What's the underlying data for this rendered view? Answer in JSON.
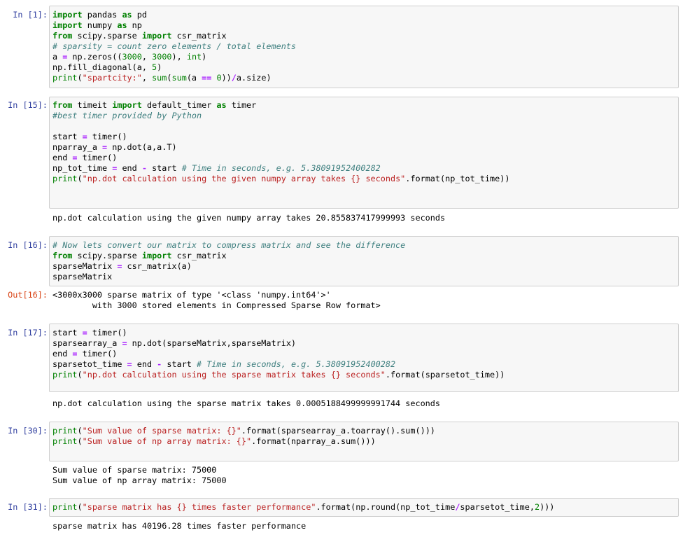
{
  "cells": [
    {
      "prompt": "In [1]:",
      "code": [
        [
          [
            "kw",
            "import"
          ],
          [
            "t",
            " pandas "
          ],
          [
            "kw",
            "as"
          ],
          [
            "t",
            " pd"
          ]
        ],
        [
          [
            "kw",
            "import"
          ],
          [
            "t",
            " numpy "
          ],
          [
            "kw",
            "as"
          ],
          [
            "t",
            " np"
          ]
        ],
        [
          [
            "kw",
            "from"
          ],
          [
            "t",
            " scipy.sparse "
          ],
          [
            "kw",
            "import"
          ],
          [
            "t",
            " csr_matrix"
          ]
        ],
        [
          [
            "cm",
            "# sparsity = count zero elements / total elements"
          ]
        ],
        [
          [
            "t",
            "a "
          ],
          [
            "op",
            "="
          ],
          [
            "t",
            " np.zeros(("
          ],
          [
            "nu",
            "3000"
          ],
          [
            "t",
            ", "
          ],
          [
            "nu",
            "3000"
          ],
          [
            "t",
            "), "
          ],
          [
            "bi",
            "int"
          ],
          [
            "t",
            ")"
          ]
        ],
        [
          [
            "t",
            "np.fill_diagonal(a, "
          ],
          [
            "nu",
            "5"
          ],
          [
            "t",
            ")"
          ]
        ],
        [
          [
            "bi",
            "print"
          ],
          [
            "t",
            "("
          ],
          [
            "st",
            "\"spartcity:\""
          ],
          [
            "t",
            ", "
          ],
          [
            "bi",
            "sum"
          ],
          [
            "t",
            "("
          ],
          [
            "bi",
            "sum"
          ],
          [
            "t",
            "(a "
          ],
          [
            "op",
            "=="
          ],
          [
            "t",
            " "
          ],
          [
            "nu",
            "0"
          ],
          [
            "t",
            "))"
          ],
          [
            "op",
            "/"
          ],
          [
            "t",
            "a.size)"
          ]
        ]
      ],
      "output": []
    },
    {
      "prompt": "In [15]:",
      "code": [
        [
          [
            "kw",
            "from"
          ],
          [
            "t",
            " timeit "
          ],
          [
            "kw",
            "import"
          ],
          [
            "t",
            " default_timer "
          ],
          [
            "kw",
            "as"
          ],
          [
            "t",
            " timer"
          ]
        ],
        [
          [
            "cm",
            "#best timer provided by Python"
          ]
        ],
        [
          [
            "t",
            ""
          ]
        ],
        [
          [
            "t",
            "start "
          ],
          [
            "op",
            "="
          ],
          [
            "t",
            " timer()"
          ]
        ],
        [
          [
            "t",
            "nparray_a "
          ],
          [
            "op",
            "="
          ],
          [
            "t",
            " np.dot(a,a.T)"
          ]
        ],
        [
          [
            "t",
            "end "
          ],
          [
            "op",
            "="
          ],
          [
            "t",
            " timer()"
          ]
        ],
        [
          [
            "t",
            "np_tot_time "
          ],
          [
            "op",
            "="
          ],
          [
            "t",
            " end "
          ],
          [
            "op",
            "-"
          ],
          [
            "t",
            " start "
          ],
          [
            "cm",
            "# Time in seconds, e.g. 5.38091952400282"
          ]
        ],
        [
          [
            "bi",
            "print"
          ],
          [
            "t",
            "("
          ],
          [
            "st",
            "\"np.dot calculation using the given numpy array takes {} seconds\""
          ],
          [
            "t",
            ".format(np_tot_time))"
          ]
        ],
        [
          [
            "t",
            ""
          ]
        ],
        [
          [
            "t",
            ""
          ]
        ]
      ],
      "output": [
        "np.dot calculation using the given numpy array takes 20.855837417999993 seconds"
      ]
    },
    {
      "prompt": "In [16]:",
      "code": [
        [
          [
            "cm",
            "# Now lets convert our matrix to compress matrix and see the difference"
          ]
        ],
        [
          [
            "kw",
            "from"
          ],
          [
            "t",
            " scipy.sparse "
          ],
          [
            "kw",
            "import"
          ],
          [
            "t",
            " csr_matrix"
          ]
        ],
        [
          [
            "t",
            "sparseMatrix "
          ],
          [
            "op",
            "="
          ],
          [
            "t",
            " csr_matrix(a)"
          ]
        ],
        [
          [
            "t",
            "sparseMatrix"
          ]
        ]
      ],
      "out_prompt": "Out[16]:",
      "output": [
        "<3000x3000 sparse matrix of type '<class 'numpy.int64'>'",
        "        with 3000 stored elements in Compressed Sparse Row format>"
      ]
    },
    {
      "prompt": "In [17]:",
      "code": [
        [
          [
            "t",
            "start "
          ],
          [
            "op",
            "="
          ],
          [
            "t",
            " timer()"
          ]
        ],
        [
          [
            "t",
            "sparsearray_a "
          ],
          [
            "op",
            "="
          ],
          [
            "t",
            " np.dot(sparseMatrix,sparseMatrix)"
          ]
        ],
        [
          [
            "t",
            "end "
          ],
          [
            "op",
            "="
          ],
          [
            "t",
            " timer()"
          ]
        ],
        [
          [
            "t",
            "sparsetot_time "
          ],
          [
            "op",
            "="
          ],
          [
            "t",
            " end "
          ],
          [
            "op",
            "-"
          ],
          [
            "t",
            " start "
          ],
          [
            "cm",
            "# Time in seconds, e.g. 5.38091952400282"
          ]
        ],
        [
          [
            "bi",
            "print"
          ],
          [
            "t",
            "("
          ],
          [
            "st",
            "\"np.dot calculation using the sparse matrix takes {} seconds\""
          ],
          [
            "t",
            ".format(sparsetot_time))"
          ]
        ],
        [
          [
            "t",
            ""
          ]
        ]
      ],
      "output": [
        "np.dot calculation using the sparse matrix takes 0.0005188499999991744 seconds"
      ]
    },
    {
      "prompt": "In [30]:",
      "code": [
        [
          [
            "bi",
            "print"
          ],
          [
            "t",
            "("
          ],
          [
            "st",
            "\"Sum value of sparse matrix: {}\""
          ],
          [
            "t",
            ".format(sparsearray_a.toarray().sum()))"
          ]
        ],
        [
          [
            "bi",
            "print"
          ],
          [
            "t",
            "("
          ],
          [
            "st",
            "\"Sum value of np array matrix: {}\""
          ],
          [
            "t",
            ".format(nparray_a.sum()))"
          ]
        ],
        [
          [
            "t",
            ""
          ]
        ]
      ],
      "output": [
        "Sum value of sparse matrix: 75000",
        "Sum value of np array matrix: 75000"
      ]
    },
    {
      "prompt": "In [31]:",
      "code": [
        [
          [
            "bi",
            "print"
          ],
          [
            "t",
            "("
          ],
          [
            "st",
            "\"sparse matrix has {} times faster performance\""
          ],
          [
            "t",
            ".format(np.round(np_tot_time"
          ],
          [
            "op",
            "/"
          ],
          [
            "t",
            "sparsetot_time,"
          ],
          [
            "nu",
            "2"
          ],
          [
            "t",
            ")))"
          ]
        ]
      ],
      "output": [
        "sparse matrix has 40196.28 times faster performance"
      ]
    }
  ]
}
